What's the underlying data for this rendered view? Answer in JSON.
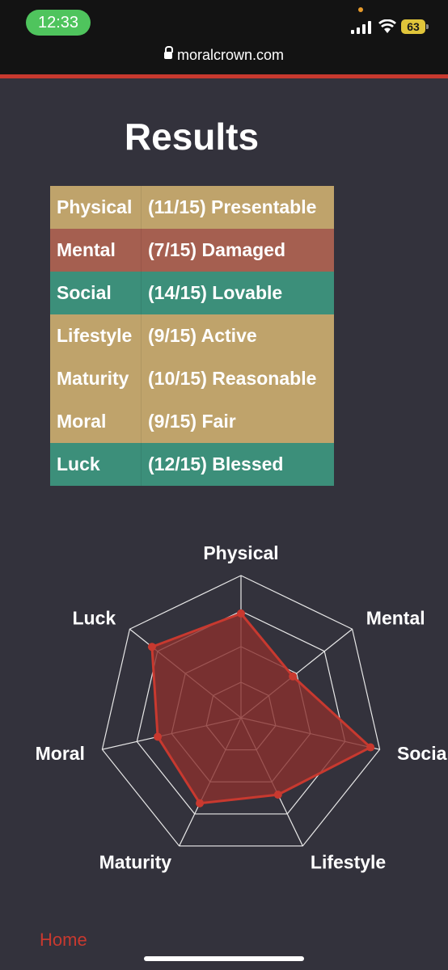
{
  "status_bar": {
    "time": "12:33",
    "battery": "63"
  },
  "browser": {
    "url": "moralcrown.com"
  },
  "page": {
    "title": "Results",
    "rows": [
      {
        "category": "Physical",
        "result": "(11/15) Presentable",
        "color": "#bfa36b"
      },
      {
        "category": "Mental",
        "result": "(7/15) Damaged",
        "color": "#a55f50"
      },
      {
        "category": "Social",
        "result": "(14/15) Lovable",
        "color": "#3c8f7a"
      },
      {
        "category": "Lifestyle",
        "result": "(9/15) Active",
        "color": "#bfa36b"
      },
      {
        "category": "Maturity",
        "result": "(10/15) Reasonable",
        "color": "#bfa36b"
      },
      {
        "category": "Moral",
        "result": "(9/15) Fair",
        "color": "#bfa36b"
      },
      {
        "category": "Luck",
        "result": "(12/15) Blessed",
        "color": "#3c8f7a"
      }
    ],
    "home_link": "Home"
  },
  "chart_data": {
    "type": "radar",
    "categories": [
      "Physical",
      "Mental",
      "Social",
      "Lifestyle",
      "Maturity",
      "Moral",
      "Luck"
    ],
    "values": [
      11,
      7,
      14,
      9,
      10,
      9,
      12
    ],
    "max": 15,
    "fill_color": "#8a2f2d",
    "stroke_color": "#c8392f"
  }
}
